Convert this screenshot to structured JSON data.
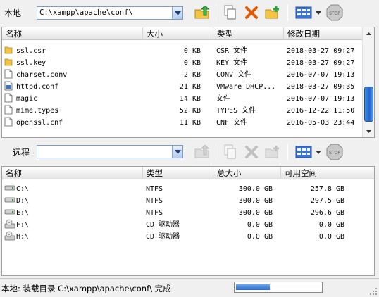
{
  "local": {
    "label": "本地",
    "path": "C:\\xampp\\apache\\conf\\",
    "columns": [
      "名称",
      "大小",
      "类型",
      "修改日期"
    ],
    "files": [
      {
        "name": "ssl.csr",
        "size": "0 KB",
        "type": "CSR 文件",
        "date": "2018-03-27 09:27",
        "icon": "folder-icon"
      },
      {
        "name": "ssl.key",
        "size": "0 KB",
        "type": "KEY 文件",
        "date": "2018-03-27 09:27",
        "icon": "folder-icon"
      },
      {
        "name": "charset.conv",
        "size": "2 KB",
        "type": "CONV 文件",
        "date": "2016-07-07 19:13",
        "icon": "file-icon"
      },
      {
        "name": "httpd.conf",
        "size": "21 KB",
        "type": "VMware DHCP...",
        "date": "2018-03-27 09:35",
        "icon": "config-file-icon"
      },
      {
        "name": "magic",
        "size": "14 KB",
        "type": "文件",
        "date": "2016-07-07 19:13",
        "icon": "file-icon"
      },
      {
        "name": "mime.types",
        "size": "52 KB",
        "type": "TYPES 文件",
        "date": "2016-12-22 11:50",
        "icon": "file-icon"
      },
      {
        "name": "openssl.cnf",
        "size": "11 KB",
        "type": "CNF 文件",
        "date": "2016-05-03 23:44",
        "icon": "file-icon"
      }
    ],
    "scroll_position": 0.6
  },
  "remote": {
    "label": "远程",
    "path": "",
    "columns": [
      "名称",
      "类型",
      "总大小",
      "可用空间"
    ],
    "drives": [
      {
        "name": "C:\\",
        "type": "NTFS",
        "total": "300.0 GB",
        "free": "257.8 GB",
        "icon": "hard-drive-icon"
      },
      {
        "name": "D:\\",
        "type": "NTFS",
        "total": "300.0 GB",
        "free": "297.5 GB",
        "icon": "hard-drive-icon"
      },
      {
        "name": "E:\\",
        "type": "NTFS",
        "total": "300.0 GB",
        "free": "296.6 GB",
        "icon": "hard-drive-icon"
      },
      {
        "name": "F:\\",
        "type": "CD 驱动器",
        "total": "0.0 GB",
        "free": "0.0 GB",
        "icon": "cd-drive-icon"
      },
      {
        "name": "H:\\",
        "type": "CD 驱动器",
        "total": "0.0 GB",
        "free": "0.0 GB",
        "icon": "cd-drive-icon"
      }
    ]
  },
  "status": {
    "text": "本地: 装载目录 C:\\xampp\\apache\\conf\\ 完成",
    "progress": 0.4
  }
}
